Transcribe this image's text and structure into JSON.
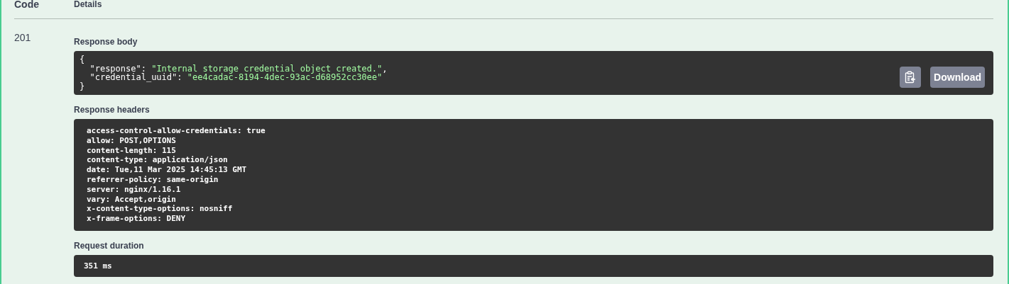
{
  "columns": [
    "Code",
    "Details"
  ],
  "response": {
    "code": "201",
    "body": {
      "label": "Response body",
      "lines": [
        {
          "kind": "plain",
          "text": "{"
        },
        {
          "kind": "pair",
          "key": "\"response\"",
          "sep": ": ",
          "value": "\"Internal storage credential object created.\"",
          "tail": ","
        },
        {
          "kind": "pair",
          "key": "\"credential_uuid\"",
          "sep": ": ",
          "value": "\"ee4cadac-8194-4dec-93ac-d68952cc30ee\""
        },
        {
          "kind": "plain",
          "text": "}"
        }
      ],
      "download": "Download"
    },
    "headers": {
      "label": "Response headers",
      "lines": [
        "access-control-allow-credentials: true",
        "allow: POST,OPTIONS",
        "content-length: 115",
        "content-type: application/json",
        "date: Tue,11 Mar 2025 14:45:13 GMT",
        "referrer-policy: same-origin",
        "server: nginx/1.16.1",
        "vary: Accept,origin",
        "x-content-type-options: nosniff",
        "x-frame-options: DENY"
      ]
    },
    "duration": {
      "label": "Request duration",
      "value": "351 ms"
    }
  }
}
